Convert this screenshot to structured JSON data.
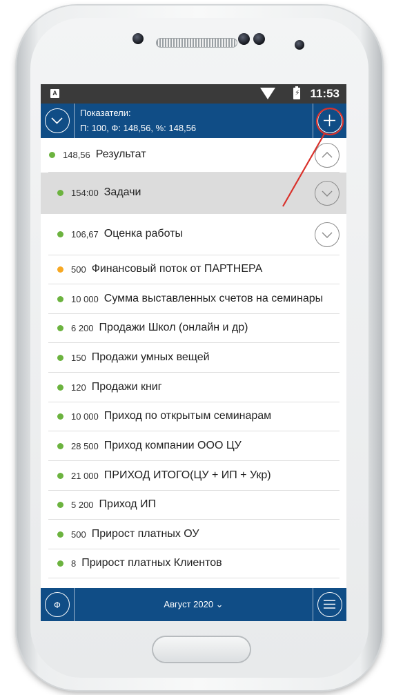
{
  "statusbar": {
    "time": "11:53",
    "app_badge": "A"
  },
  "header": {
    "title": "Показатели:",
    "summary": "П: 100, Ф: 148,56, %: 148,56"
  },
  "colors": {
    "primary": "#104d86",
    "ok": "#6cb33f",
    "warn": "#f7a823",
    "highlight_row": "#dcdcdc",
    "annotation": "#d9312b"
  },
  "rows": [
    {
      "value": "148,56",
      "label": "Результат",
      "status": "ok",
      "expander": "chevron-up"
    },
    {
      "value": "154:00",
      "label": "Задачи",
      "status": "ok",
      "expander": "chevron-down",
      "highlighted": true
    },
    {
      "value": "106,67",
      "label": "Оценка работы",
      "status": "ok",
      "expander": "chevron-down"
    },
    {
      "value": "500",
      "label": "Финансовый поток от ПАРТНЕРА",
      "status": "warn"
    },
    {
      "value": "10 000",
      "label": "Сумма выставленных счетов на семинары",
      "status": "ok"
    },
    {
      "value": "6 200",
      "label": "Продажи Школ (онлайн и др)",
      "status": "ok"
    },
    {
      "value": "150",
      "label": "Продажи умных вещей",
      "status": "ok"
    },
    {
      "value": "120",
      "label": "Продажи книг",
      "status": "ok"
    },
    {
      "value": "10 000",
      "label": "Приход по открытым семинарам",
      "status": "ok"
    },
    {
      "value": "28 500",
      "label": "Приход компании ООО ЦУ",
      "status": "ok"
    },
    {
      "value": "21 000",
      "label": "ПРИХОД ИТОГО(ЦУ + ИП + Укр)",
      "status": "ok"
    },
    {
      "value": "5 200",
      "label": "Приход ИП",
      "status": "ok"
    },
    {
      "value": "500",
      "label": "Прирост платных ОУ",
      "status": "ok"
    },
    {
      "value": "8",
      "label": "Прирост платных Клиентов",
      "status": "ok"
    }
  ],
  "footer": {
    "left_icon_glyph": "Ф",
    "month": "Август 2020 ⌄"
  },
  "icons": {
    "header_left": "chevron-down-icon",
    "header_right": "plus-icon",
    "footer_left": "ruble-icon",
    "footer_right": "menu-icon"
  }
}
